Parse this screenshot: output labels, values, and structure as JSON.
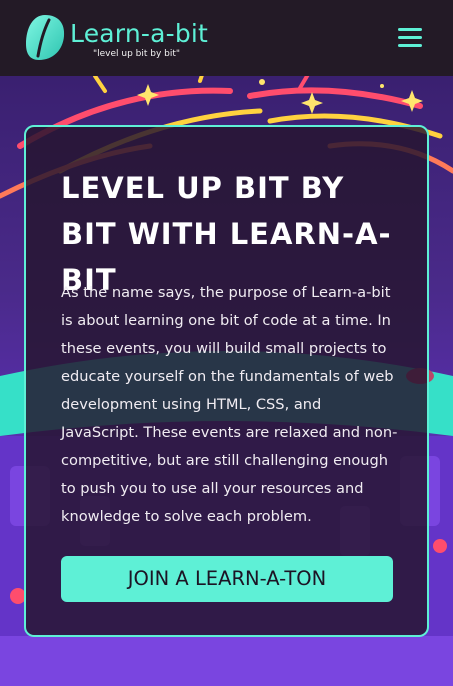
{
  "header": {
    "brand_name": "Learn-a-bit",
    "tagline": "\"level up bit by bit\"",
    "logo_icon": "leaf-logo-icon",
    "menu_icon": "hamburger-menu-icon"
  },
  "hero": {
    "title": "LEVEL UP BIT BY BIT WITH LEARN-A-BIT",
    "body": "As the name says, the purpose of Learn-a-bit is about learning one bit of code at a time. In these events, you will build small projects to educate yourself on the fundamentals of web development using HTML, CSS, and JavaScript. These events are relaxed and non-competitive, but are still challenging enough to push you to use all your resources and knowledge to solve each problem.",
    "cta_label": "JOIN A LEARN-A-TON"
  },
  "colors": {
    "accent": "#5ef0d6",
    "header_bg": "#231a26",
    "card_bg": "#261630",
    "text": "#ffffff"
  }
}
